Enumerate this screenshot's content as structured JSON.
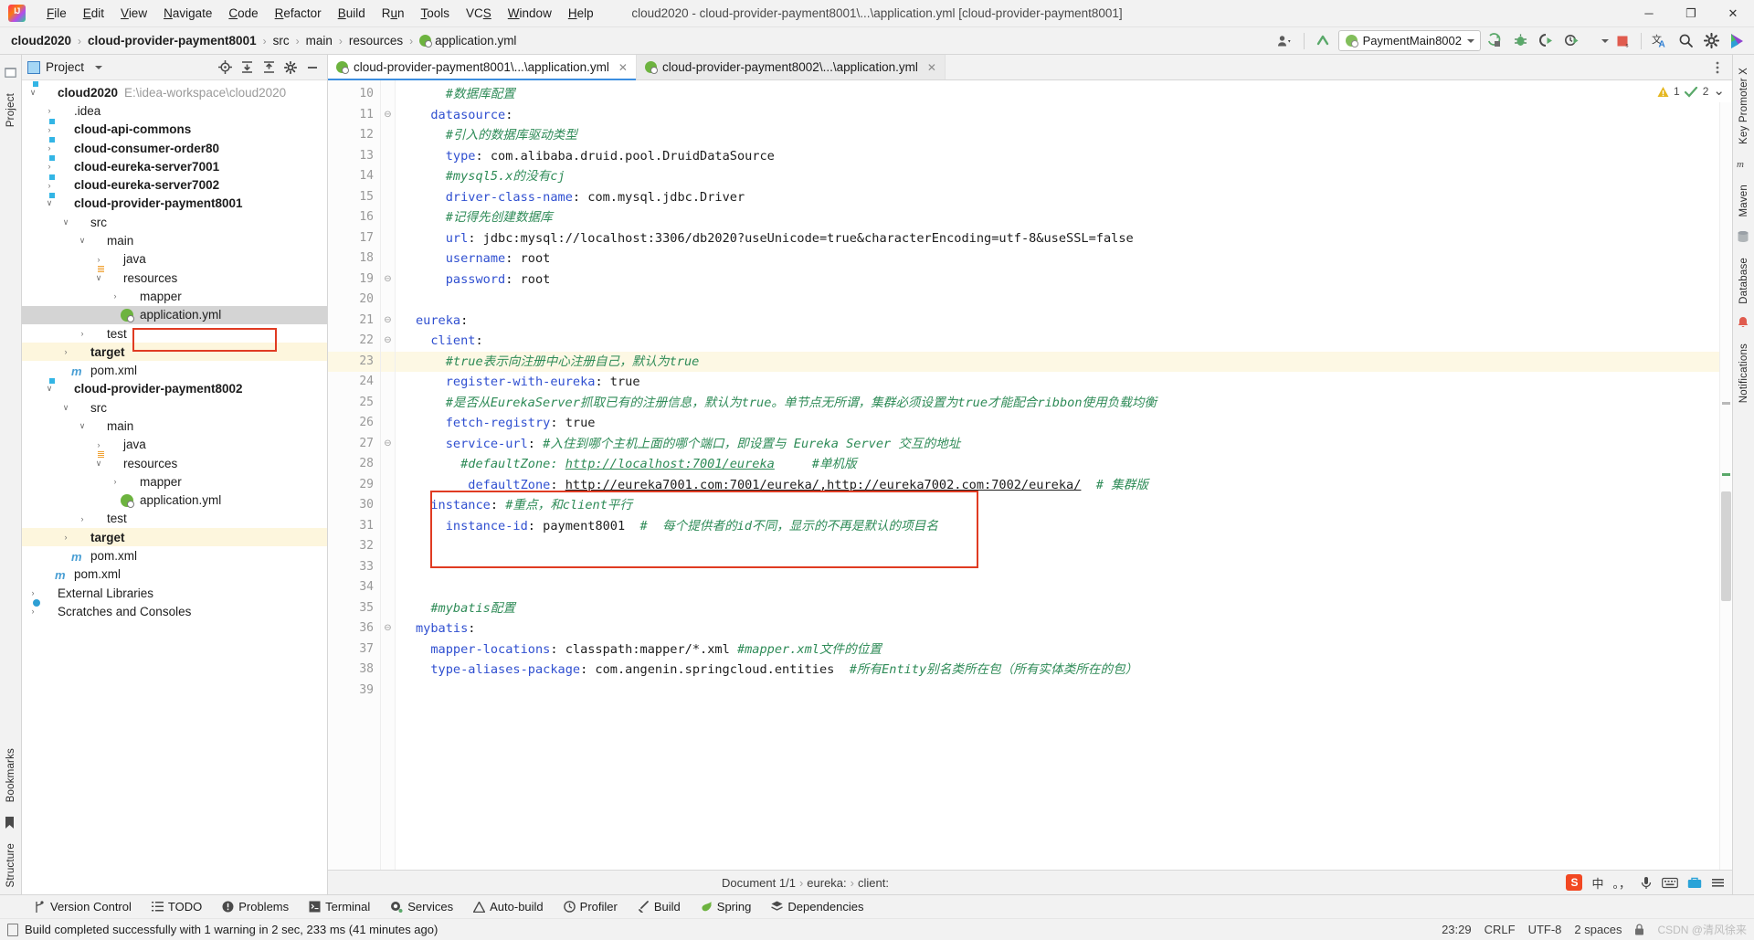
{
  "window": {
    "title": "cloud2020 - cloud-provider-payment8001\\...\\application.yml [cloud-provider-payment8001]",
    "minimize": "─",
    "maximize": "❐",
    "close": "✕"
  },
  "menubar": [
    "File",
    "Edit",
    "View",
    "Navigate",
    "Code",
    "Refactor",
    "Build",
    "Run",
    "Tools",
    "VCS",
    "Window",
    "Help"
  ],
  "breadcrumb": {
    "items": [
      "cloud2020",
      "cloud-provider-payment8001",
      "src",
      "main",
      "resources",
      "application.yml"
    ],
    "separator": "›"
  },
  "toolbar": {
    "run_config": "PaymentMain8002",
    "buttons": [
      "profile-icon",
      "update-icon",
      "run-icon",
      "debug-icon",
      "run-coverage-icon",
      "profiler-run-icon",
      "stop-icon",
      "translate-icon",
      "search-icon",
      "settings-icon",
      "idea-assistant-icon"
    ]
  },
  "sidebar_left": {
    "tabs": [
      "Project",
      "Bookmarks",
      "Structure"
    ]
  },
  "sidebar_right": {
    "tabs": [
      "Key Promoter X",
      "Maven",
      "Database",
      "Notifications"
    ]
  },
  "project_panel": {
    "title": "Project",
    "actions": [
      "locate-icon",
      "expand-all-icon",
      "collapse-all-icon",
      "settings-icon",
      "hide-icon"
    ],
    "tree": [
      {
        "depth": 0,
        "arrow": "∨",
        "icon": "module",
        "label": "cloud2020",
        "bold": true,
        "sub": "E:\\idea-workspace\\cloud2020"
      },
      {
        "depth": 1,
        "arrow": "›",
        "icon": "folder",
        "label": ".idea",
        "bold": false,
        "sub": ""
      },
      {
        "depth": 1,
        "arrow": "›",
        "icon": "module",
        "label": "cloud-api-commons",
        "bold": true,
        "sub": ""
      },
      {
        "depth": 1,
        "arrow": "›",
        "icon": "module",
        "label": "cloud-consumer-order80",
        "bold": true,
        "sub": ""
      },
      {
        "depth": 1,
        "arrow": "›",
        "icon": "module",
        "label": "cloud-eureka-server7001",
        "bold": true,
        "sub": ""
      },
      {
        "depth": 1,
        "arrow": "›",
        "icon": "module",
        "label": "cloud-eureka-server7002",
        "bold": true,
        "sub": ""
      },
      {
        "depth": 1,
        "arrow": "∨",
        "icon": "module",
        "label": "cloud-provider-payment8001",
        "bold": true,
        "sub": ""
      },
      {
        "depth": 2,
        "arrow": "∨",
        "icon": "folder",
        "label": "src",
        "bold": false,
        "sub": ""
      },
      {
        "depth": 3,
        "arrow": "∨",
        "icon": "folder",
        "label": "main",
        "bold": false,
        "sub": ""
      },
      {
        "depth": 4,
        "arrow": "›",
        "icon": "source",
        "label": "java",
        "bold": false,
        "sub": ""
      },
      {
        "depth": 4,
        "arrow": "∨",
        "icon": "resource",
        "label": "resources",
        "bold": false,
        "sub": ""
      },
      {
        "depth": 5,
        "arrow": "›",
        "icon": "folder",
        "label": "mapper",
        "bold": false,
        "sub": ""
      },
      {
        "depth": 5,
        "arrow": "",
        "icon": "spring",
        "label": "application.yml",
        "bold": false,
        "sub": "",
        "selected": true
      },
      {
        "depth": 3,
        "arrow": "›",
        "icon": "folder",
        "label": "test",
        "bold": false,
        "sub": ""
      },
      {
        "depth": 2,
        "arrow": "›",
        "icon": "target",
        "label": "target",
        "bold": true,
        "sub": "",
        "highlight": true
      },
      {
        "depth": 2,
        "arrow": "",
        "icon": "maven",
        "label": "pom.xml",
        "bold": false,
        "sub": ""
      },
      {
        "depth": 1,
        "arrow": "∨",
        "icon": "module",
        "label": "cloud-provider-payment8002",
        "bold": true,
        "sub": ""
      },
      {
        "depth": 2,
        "arrow": "∨",
        "icon": "folder",
        "label": "src",
        "bold": false,
        "sub": ""
      },
      {
        "depth": 3,
        "arrow": "∨",
        "icon": "folder",
        "label": "main",
        "bold": false,
        "sub": ""
      },
      {
        "depth": 4,
        "arrow": "›",
        "icon": "source",
        "label": "java",
        "bold": false,
        "sub": ""
      },
      {
        "depth": 4,
        "arrow": "∨",
        "icon": "resource",
        "label": "resources",
        "bold": false,
        "sub": ""
      },
      {
        "depth": 5,
        "arrow": "›",
        "icon": "folder",
        "label": "mapper",
        "bold": false,
        "sub": ""
      },
      {
        "depth": 5,
        "arrow": "",
        "icon": "spring",
        "label": "application.yml",
        "bold": false,
        "sub": ""
      },
      {
        "depth": 3,
        "arrow": "›",
        "icon": "folder",
        "label": "test",
        "bold": false,
        "sub": ""
      },
      {
        "depth": 2,
        "arrow": "›",
        "icon": "target",
        "label": "target",
        "bold": true,
        "sub": "",
        "highlight": true
      },
      {
        "depth": 2,
        "arrow": "",
        "icon": "maven",
        "label": "pom.xml",
        "bold": false,
        "sub": ""
      },
      {
        "depth": 1,
        "arrow": "",
        "icon": "maven",
        "label": "pom.xml",
        "bold": false,
        "sub": ""
      },
      {
        "depth": 0,
        "arrow": "›",
        "icon": "libs",
        "label": "External Libraries",
        "bold": false,
        "sub": ""
      },
      {
        "depth": 0,
        "arrow": "›",
        "icon": "scratch",
        "label": "Scratches and Consoles",
        "bold": false,
        "sub": ""
      }
    ]
  },
  "editor": {
    "tabs": [
      {
        "label": "cloud-provider-payment8001\\...\\application.yml",
        "active": true,
        "close": "✕"
      },
      {
        "label": "cloud-provider-payment8002\\...\\application.yml",
        "active": false,
        "close": "✕"
      }
    ],
    "inspection": {
      "warning_count": "1",
      "ok_count": "2",
      "chevron": "⌄"
    },
    "first_line_number": 10,
    "lines": [
      {
        "n": 10,
        "fold": "",
        "indent": "    ",
        "tokens": [
          {
            "t": "cm",
            "s": "#数据库配置"
          }
        ]
      },
      {
        "n": 11,
        "fold": "−",
        "indent": "  ",
        "tokens": [
          {
            "t": "k",
            "s": "datasource"
          },
          {
            "t": "v",
            "s": ":"
          }
        ]
      },
      {
        "n": 12,
        "fold": "",
        "indent": "    ",
        "tokens": [
          {
            "t": "cm",
            "s": "#引入的数据库驱动类型"
          }
        ]
      },
      {
        "n": 13,
        "fold": "",
        "indent": "    ",
        "tokens": [
          {
            "t": "k",
            "s": "type"
          },
          {
            "t": "v",
            "s": ": com.alibaba.druid.pool.DruidDataSource"
          }
        ]
      },
      {
        "n": 14,
        "fold": "",
        "indent": "    ",
        "tokens": [
          {
            "t": "cm",
            "s": "#mysql5.x的没有cj"
          }
        ]
      },
      {
        "n": 15,
        "fold": "",
        "indent": "    ",
        "tokens": [
          {
            "t": "k",
            "s": "driver-class-name"
          },
          {
            "t": "v",
            "s": ": com.mysql.jdbc.Driver"
          }
        ]
      },
      {
        "n": 16,
        "fold": "",
        "indent": "    ",
        "tokens": [
          {
            "t": "cm",
            "s": "#记得先创建数据库"
          }
        ]
      },
      {
        "n": 17,
        "fold": "",
        "indent": "    ",
        "tokens": [
          {
            "t": "k",
            "s": "url"
          },
          {
            "t": "v",
            "s": ": jdbc:mysql://localhost:3306/db2020?useUnicode=true&characterEncoding=utf-8&useSSL=false"
          }
        ]
      },
      {
        "n": 18,
        "fold": "",
        "indent": "    ",
        "tokens": [
          {
            "t": "k",
            "s": "username"
          },
          {
            "t": "v",
            "s": ": root"
          }
        ]
      },
      {
        "n": 19,
        "fold": "−",
        "indent": "    ",
        "tokens": [
          {
            "t": "k",
            "s": "password"
          },
          {
            "t": "v",
            "s": ": root"
          }
        ]
      },
      {
        "n": 20,
        "fold": "",
        "indent": "",
        "tokens": []
      },
      {
        "n": 21,
        "fold": "−",
        "indent": "",
        "tokens": [
          {
            "t": "k",
            "s": "eureka"
          },
          {
            "t": "v",
            "s": ":"
          }
        ]
      },
      {
        "n": 22,
        "fold": "−",
        "indent": "  ",
        "tokens": [
          {
            "t": "k",
            "s": "client"
          },
          {
            "t": "v",
            "s": ":"
          }
        ]
      },
      {
        "n": 23,
        "fold": "",
        "indent": "    ",
        "hl": true,
        "tokens": [
          {
            "t": "cm",
            "s": "#true表示向注册中心注册自己，默认为true"
          }
        ]
      },
      {
        "n": 24,
        "fold": "",
        "indent": "    ",
        "tokens": [
          {
            "t": "k",
            "s": "register-with-eureka"
          },
          {
            "t": "v",
            "s": ": true"
          }
        ]
      },
      {
        "n": 25,
        "fold": "",
        "indent": "    ",
        "tokens": [
          {
            "t": "cm",
            "s": "#是否从EurekaServer抓取已有的注册信息，默认为true。单节点无所谓，集群必须设置为true才能配合ribbon使用负载均衡"
          }
        ]
      },
      {
        "n": 26,
        "fold": "",
        "indent": "    ",
        "tokens": [
          {
            "t": "k",
            "s": "fetch-registry"
          },
          {
            "t": "v",
            "s": ": true"
          }
        ]
      },
      {
        "n": 27,
        "fold": "−",
        "indent": "    ",
        "tokens": [
          {
            "t": "k",
            "s": "service-url"
          },
          {
            "t": "v",
            "s": ": "
          },
          {
            "t": "cm",
            "s": "#入住到哪个主机上面的哪个端口，即设置与 Eureka Server 交互的地址"
          }
        ]
      },
      {
        "n": 28,
        "fold": "",
        "indent": "      ",
        "tokens": [
          {
            "t": "cm",
            "s": "#defaultZone: "
          },
          {
            "t": "lnk",
            "s": "http://localhost:7001/eureka"
          },
          {
            "t": "cm",
            "s": "     #单机版"
          }
        ]
      },
      {
        "n": 29,
        "fold": "",
        "indent": "       ",
        "tokens": [
          {
            "t": "k",
            "s": "defaultZone"
          },
          {
            "t": "v",
            "s": ": "
          },
          {
            "t": "lnkb",
            "s": "http://eureka7001.com:7001/eureka/,http://eureka7002.com:7002/eureka/"
          },
          {
            "t": "cm",
            "s": "  # 集群版"
          }
        ]
      },
      {
        "n": 30,
        "fold": "",
        "indent": "  ",
        "tokens": [
          {
            "t": "k",
            "s": "instance"
          },
          {
            "t": "v",
            "s": ": "
          },
          {
            "t": "cm",
            "s": "#重点，和client平行"
          }
        ]
      },
      {
        "n": 31,
        "fold": "",
        "indent": "    ",
        "tokens": [
          {
            "t": "k",
            "s": "instance-id"
          },
          {
            "t": "v",
            "s": ": payment8001  "
          },
          {
            "t": "cm",
            "s": "#  每个提供者的id不同，显示的不再是默认的项目名"
          }
        ]
      },
      {
        "n": 32,
        "fold": "",
        "indent": "",
        "tokens": []
      },
      {
        "n": 33,
        "fold": "",
        "indent": "",
        "tokens": []
      },
      {
        "n": 34,
        "fold": "",
        "indent": "",
        "tokens": []
      },
      {
        "n": 35,
        "fold": "",
        "indent": "  ",
        "tokens": [
          {
            "t": "cm",
            "s": "#mybatis配置"
          }
        ]
      },
      {
        "n": 36,
        "fold": "−",
        "indent": "",
        "tokens": [
          {
            "t": "k",
            "s": "mybatis"
          },
          {
            "t": "v",
            "s": ":"
          }
        ]
      },
      {
        "n": 37,
        "fold": "",
        "indent": "  ",
        "tokens": [
          {
            "t": "k",
            "s": "mapper-locations"
          },
          {
            "t": "v",
            "s": ": classpath:mapper/*.xml "
          },
          {
            "t": "cm",
            "s": "#mapper.xml文件的位置"
          }
        ]
      },
      {
        "n": 38,
        "fold": "",
        "indent": "  ",
        "tokens": [
          {
            "t": "k",
            "s": "type-aliases-package"
          },
          {
            "t": "v",
            "s": ": com.angenin.springcloud.entities  "
          },
          {
            "t": "cm",
            "s": "#所有Entity别名类所在包（所有实体类所在的包）"
          }
        ]
      },
      {
        "n": 39,
        "fold": "",
        "indent": "",
        "tokens": []
      }
    ]
  },
  "document_bar": {
    "document": "Document 1/1",
    "path": [
      "eureka:",
      "client:"
    ],
    "separator": "›"
  },
  "tool_windows": [
    {
      "label": "Version Control",
      "icon": "branch-icon"
    },
    {
      "label": "TODO",
      "icon": "list-icon"
    },
    {
      "label": "Problems",
      "icon": "warning-icon"
    },
    {
      "label": "Terminal",
      "icon": "terminal-icon"
    },
    {
      "label": "Services",
      "icon": "services-icon"
    },
    {
      "label": "Auto-build",
      "icon": "autobuild-icon"
    },
    {
      "label": "Profiler",
      "icon": "profiler-icon"
    },
    {
      "label": "Build",
      "icon": "hammer-icon"
    },
    {
      "label": "Spring",
      "icon": "spring-icon"
    },
    {
      "label": "Dependencies",
      "icon": "dependencies-icon"
    }
  ],
  "status_bar": {
    "message": "Build completed successfully with 1 warning in 2 sec, 233 ms (41 minutes ago)",
    "time": "23:29",
    "line_sep": "CRLF",
    "encoding": "UTF-8",
    "indent": "2 spaces",
    "lock": "lock-icon",
    "watermark": "CSDN @清风徐来"
  },
  "ime_bar": {
    "items": [
      "sogou-logo",
      "中",
      "。，",
      "mic-icon",
      "keyboard-icon",
      "toolbox-icon",
      "menu-icon"
    ]
  }
}
